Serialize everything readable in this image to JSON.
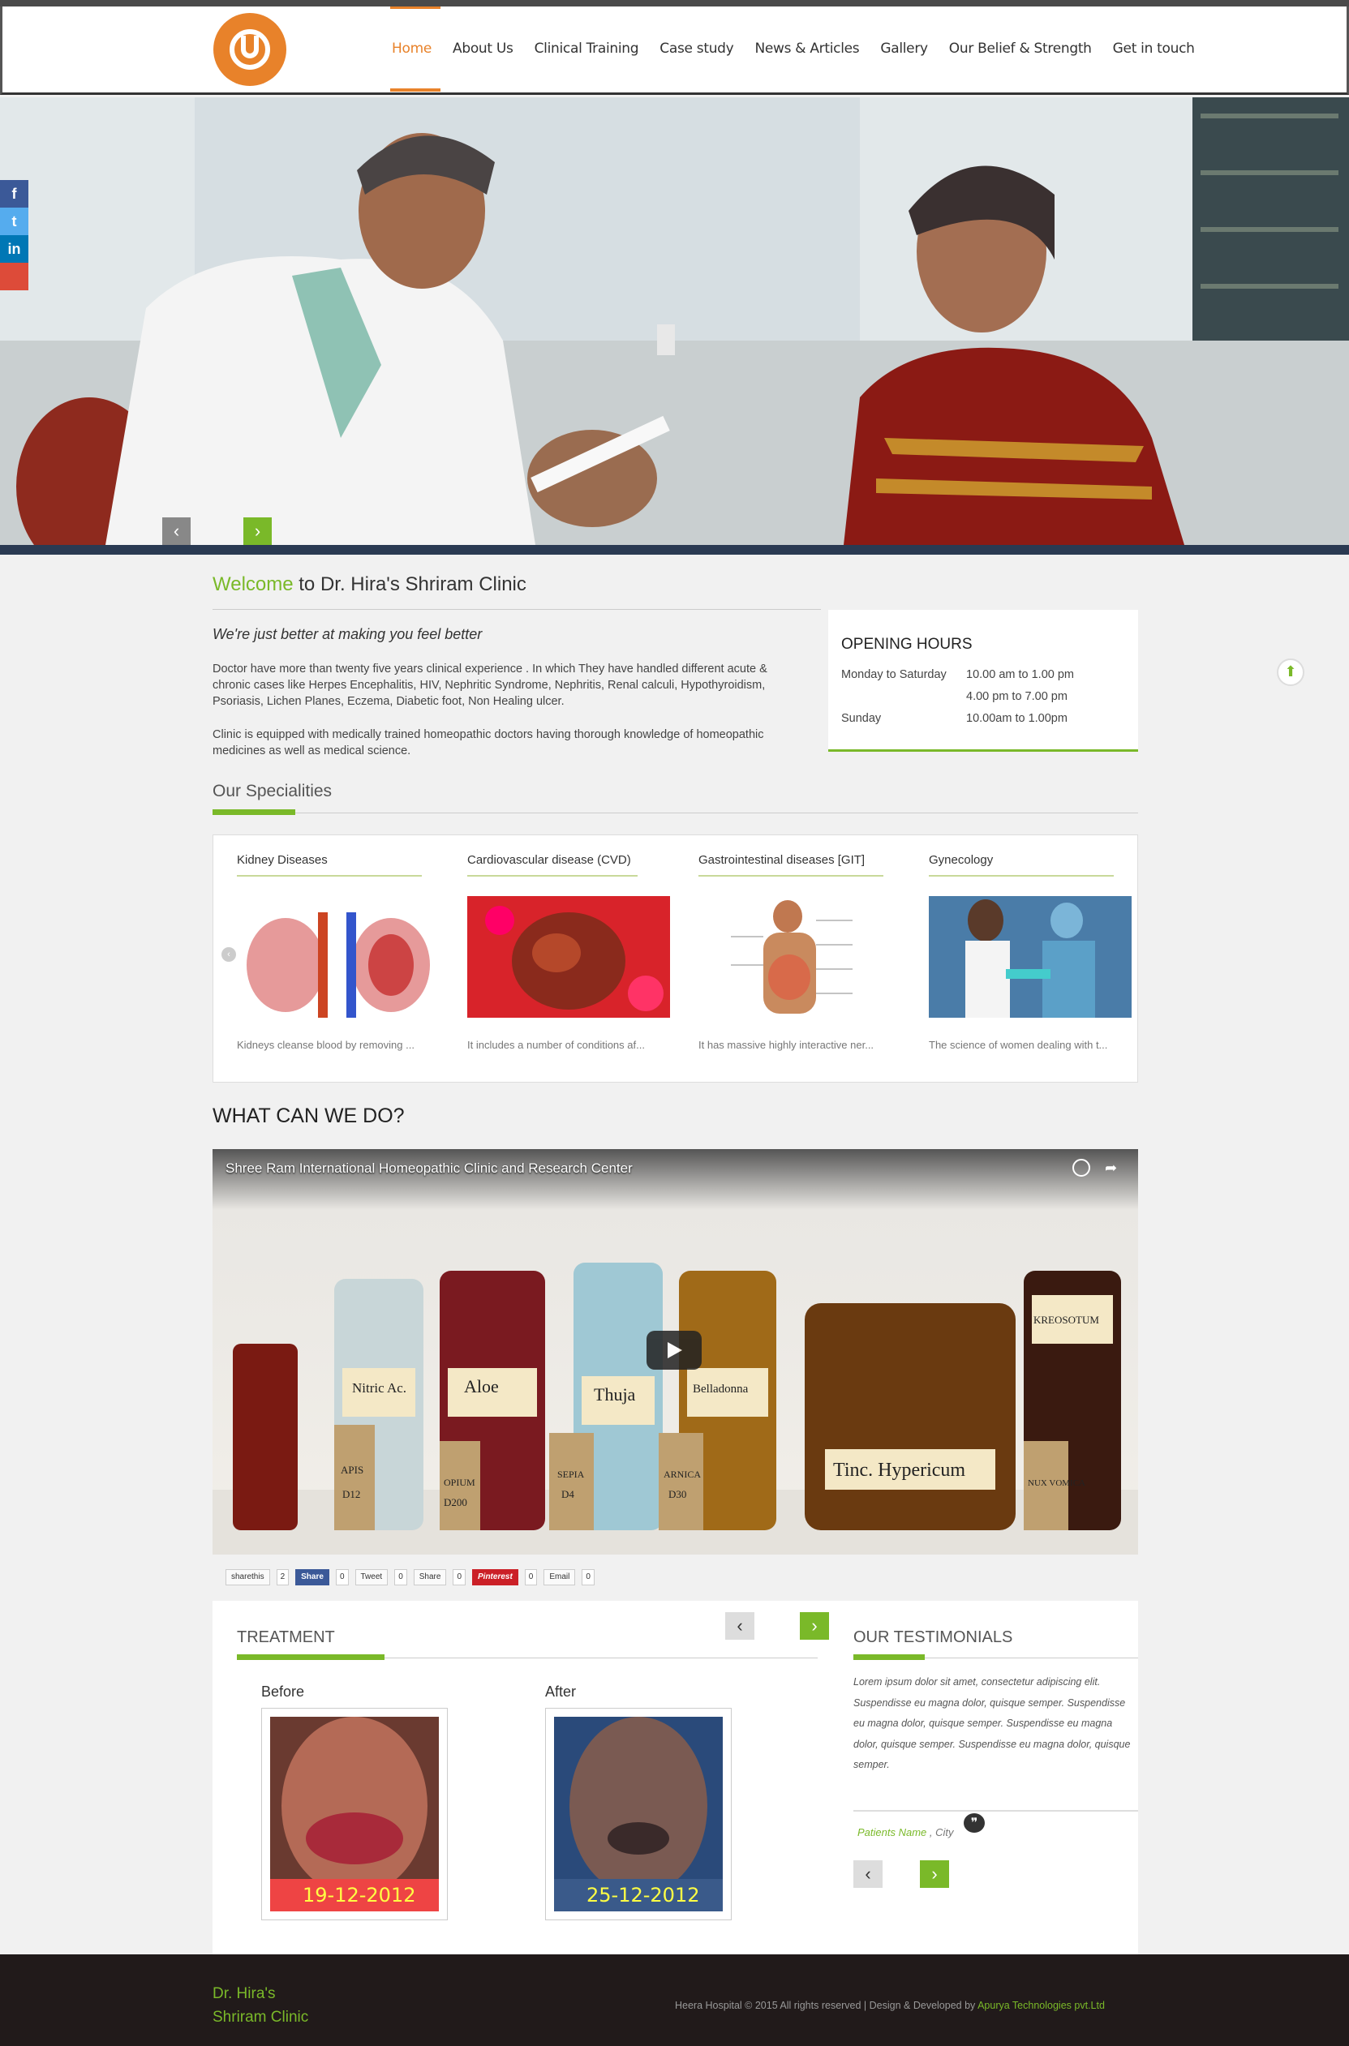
{
  "nav": {
    "items": [
      "Home",
      "About Us",
      "Clinical Training",
      "Case study",
      "News & Articles",
      "Gallery",
      "Our Belief & Strength",
      "Get in touch"
    ]
  },
  "social": {
    "icons": [
      "facebook-icon",
      "twitter-icon",
      "linkedin-icon",
      "google-plus-icon"
    ],
    "labels": [
      "f",
      "t",
      "in",
      ""
    ]
  },
  "slider": {
    "prev": "‹",
    "next": "›"
  },
  "welcome": {
    "highlight": "Welcome",
    "rest": " to Dr. Hira's Shriram Clinic",
    "tagline": "We're just better at making you feel better",
    "p1": "Doctor have more than twenty five years clinical experience . In which They have handled different acute & chronic cases like Herpes Encephalitis, HIV, Nephritic Syndrome, Nephritis, Renal calculi, Hypothyroidism, Psoriasis, Lichen Planes, Eczema, Diabetic foot, Non Healing ulcer.",
    "p2": "Clinic is equipped with medically trained homeopathic doctors having thorough knowledge of homeopathic medicines as well as medical science."
  },
  "hours": {
    "title": "OPENING HOURS",
    "rows": [
      {
        "day": "Monday to Saturday",
        "time": "10.00 am to 1.00 pm"
      },
      {
        "day": "",
        "time": "4.00 pm to 7.00 pm"
      },
      {
        "day": "Sunday",
        "time": "10.00am to 1.00pm"
      }
    ]
  },
  "specialities": {
    "title": "Our  Specialities",
    "cards": [
      {
        "title": "Kidney Diseases",
        "desc": "Kidneys cleanse blood by removing ..."
      },
      {
        "title": "Cardiovascular disease (CVD)",
        "desc": "It includes a number of conditions af..."
      },
      {
        "title": "Gastrointestinal diseases [GIT]",
        "desc": "It has massive highly interactive ner..."
      },
      {
        "title": "Gynecology",
        "desc": "The science of women dealing with t..."
      }
    ]
  },
  "what": {
    "title": "WHAT CAN  WE DO?"
  },
  "video": {
    "title": "Shree Ram International Homeopathic Clinic and Research Center",
    "labels": [
      "Nitric Ac.",
      "Aloe",
      "Thuja",
      "Belladonna",
      "KREOSOTUM",
      "Tinc. Hypericum",
      "APIS",
      "OPIUM",
      "SEPIA",
      "ARNICA",
      "NUX VOMICA",
      "D12",
      "D200",
      "D4",
      "D30"
    ]
  },
  "share": {
    "buttons": [
      {
        "label": "sharethis",
        "count": "2"
      },
      {
        "label": "Share",
        "count": "0"
      },
      {
        "label": "Tweet",
        "count": "0"
      },
      {
        "label": "Share",
        "count": "0"
      },
      {
        "label": "Pinterest",
        "count": "0"
      },
      {
        "label": "Email",
        "count": "0"
      }
    ]
  },
  "treatment": {
    "title": "TREATMENT",
    "before": "Before",
    "after": "After",
    "before_date": "19-12-2012",
    "after_date": "25-12-2012"
  },
  "testimonials": {
    "title": "OUR  TESTIMONIALS",
    "text": "Lorem ipsum dolor sit amet, consectetur adipiscing elit. Suspendisse eu magna dolor, quisque semper. Suspendisse eu magna dolor, quisque semper. Suspendisse eu magna dolor, quisque semper. Suspendisse eu magna dolor, quisque semper.",
    "name": "Patients Name",
    "city": " , City"
  },
  "footer": {
    "brand1": "Dr. Hira's",
    "brand2": "Shriram Clinic",
    "copy": "Heera Hospital © 2015 All rights reserved | Design & Developed by ",
    "dev": "Apurya Technologies pvt.Ltd"
  },
  "colors": {
    "accent": "#7ab929",
    "orange": "#e8822a",
    "footer": "#211a1a",
    "hero_bar": "#2a3a52"
  }
}
